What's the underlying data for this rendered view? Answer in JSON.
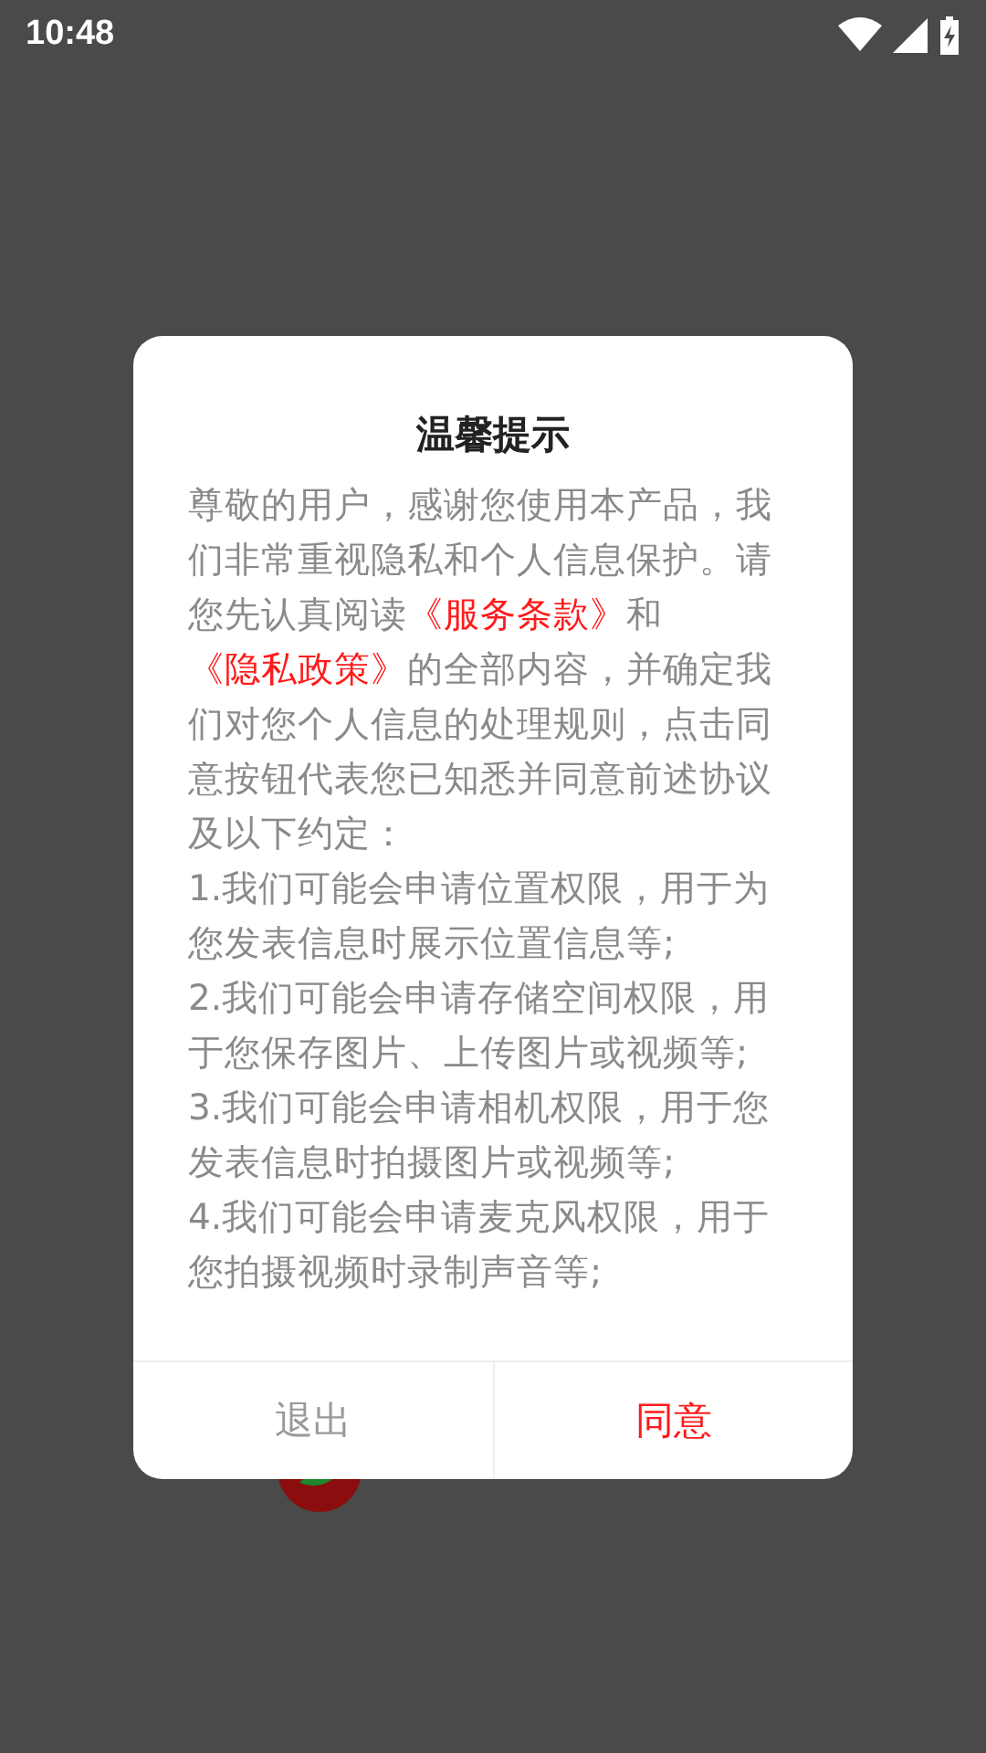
{
  "status_bar": {
    "time": "10:48"
  },
  "dialog": {
    "title": "温馨提示",
    "intro": [
      {
        "text": "尊敬的用户，感谢您使用本产品，我们非常重视隐私和个人信息保护。请您先认真阅读",
        "kind": "plain"
      },
      {
        "text": "《服务条款》",
        "kind": "link"
      },
      {
        "text": "和",
        "kind": "plain"
      },
      {
        "text": "《隐私政策》",
        "kind": "link"
      },
      {
        "text": "的全部内容，并确定我们对您个人信息的处理规则，点击同意按钮代表您已知悉并同意前述协议及以下约定：",
        "kind": "plain"
      }
    ],
    "items": [
      "1.我们可能会申请位置权限，用于为您发表信息时展示位置信息等;",
      "2.我们可能会申请存储空间权限，用于您保存图片、上传图片或视频等;",
      "3.我们可能会申请相机权限，用于您发表信息时拍摄图片或视频等;",
      "4.我们可能会申请麦克风权限，用于您拍摄视频时录制声音等;"
    ],
    "buttons": [
      {
        "label": "退出",
        "kind": "cancel"
      },
      {
        "label": "同意",
        "kind": "confirm"
      }
    ]
  }
}
